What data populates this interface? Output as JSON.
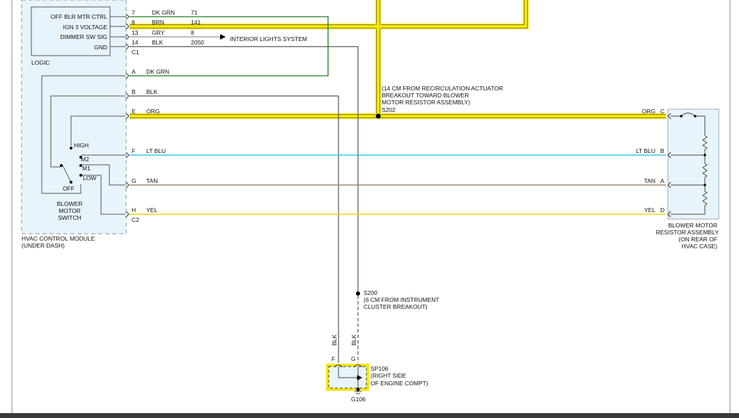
{
  "logic": {
    "box_label": "LOGIC",
    "pin_labels": [
      "OFF BLR MTR CTRL",
      "IGN 3 VOLTAGE",
      "DIMMER SW SIG",
      "GND"
    ]
  },
  "c1": {
    "label": "C1",
    "pins": [
      "7",
      "8",
      "13",
      "14"
    ],
    "colors": [
      "DK GRN",
      "BRN",
      "GRY",
      "BLK"
    ],
    "circuits": [
      "71",
      "141",
      "8",
      "2050"
    ]
  },
  "interior_lights": "INTERIOR LIGHTS SYSTEM",
  "c2": {
    "label": "C2",
    "pins": [
      "A",
      "B",
      "E",
      "F",
      "G",
      "H"
    ],
    "colors": [
      "DK GRN",
      "BLK",
      "ORG",
      "LT BLU",
      "TAN",
      "YEL"
    ]
  },
  "switch": {
    "positions": [
      "HIGH",
      "M2",
      "M1",
      "LOW",
      "OFF"
    ],
    "name_lines": [
      "BLOWER",
      "MOTOR",
      "SWITCH"
    ]
  },
  "hvac_module": [
    "HVAC CONTROL MODULE",
    "(UNDER DASH)"
  ],
  "s202": {
    "note_lines": [
      "(14 CM FROM RECIRCULATION ACTUATOR",
      "BREAKOUT TOWARD BLOWER",
      "MOTOR RESISTOR ASSEMBLY)"
    ],
    "label": "S202"
  },
  "resistor": {
    "wires": [
      {
        "color": "ORG",
        "pin": "C"
      },
      {
        "color": "LT BLU",
        "pin": "B"
      },
      {
        "color": "TAN",
        "pin": "A"
      },
      {
        "color": "YEL",
        "pin": "D"
      }
    ],
    "name_lines": [
      "BLOWER MOTOR",
      "RESISTOR ASSEMBLY",
      "(ON REAR OF",
      "HVAC CASE)"
    ]
  },
  "s200": {
    "label": "S200",
    "note_lines": [
      "(6 CM FROM INSTRUMENT",
      "CLUSTER BREAKOUT)"
    ]
  },
  "sp106": {
    "wire_labels": [
      "BLK",
      "BLK"
    ],
    "pins": [
      "F",
      "G"
    ],
    "lines": [
      "SP106",
      "(RIGHT SIDE",
      "OF ENGINE COMPT)"
    ],
    "ground": "G106"
  },
  "colors": {
    "highlight": "#f5e600",
    "highlight_dark": "#2a2000",
    "dk_grn": "#1a7a1a",
    "lt_blu": "#35c8dc",
    "tan": "#9a8a72",
    "yel": "#f0dc28",
    "wire": "#555555",
    "box_fill": "#e8f4fb",
    "box_border": "#9aa8b0"
  }
}
